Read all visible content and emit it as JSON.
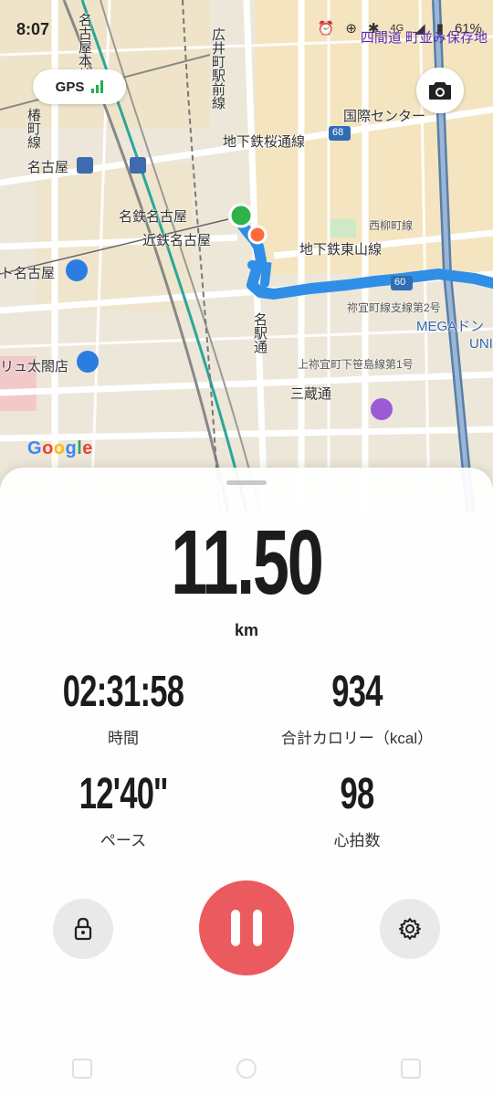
{
  "status_bar": {
    "time": "8:07",
    "icons": [
      "alarm-icon",
      "sync-icon",
      "bluetooth-icon",
      "4g-icon",
      "signal-icon",
      "battery-icon"
    ],
    "battery": "61%",
    "network": "4G",
    "overlay_text": "四間道 町並み保存地"
  },
  "gps": {
    "label": "GPS",
    "color": "#21b04b"
  },
  "map": {
    "labels": {
      "meieki_ave": "名駅通",
      "sakuradori": "地下鉄桜通線",
      "higashiyama": "地下鉄東山線",
      "nagoya_sta": "名古屋",
      "meitetsu": "名鉄名古屋",
      "kintetsu": "近鉄名古屋",
      "kokusai": "国際センター",
      "sanzo": "三蔵通",
      "taiko": "リュ太閤店",
      "nagoya2": "ト名古屋",
      "hirokoji": "広井町駅前線",
      "tsubakicho": "椿町線",
      "mega": "MEGAドン",
      "uni": "UNI",
      "nishiyanagi": "西柳町線",
      "negi": "祢宜町線支線第2号",
      "kami": "上祢宜町下笹島線第1号",
      "kinkoku": "名古屋本線",
      "road68": "68",
      "road60": "60"
    },
    "google": "Google",
    "route_color": "#2f8fe6"
  },
  "stats": {
    "distance": "11.50",
    "distance_unit": "km",
    "time_value": "02:31:58",
    "time_label": "時間",
    "calories_value": "934",
    "calories_label": "合計カロリー（kcal）",
    "pace_value": "12'40''",
    "pace_label": "ペース",
    "heart_value": "98",
    "heart_label": "心拍数"
  },
  "controls": {
    "lock": "lock-icon",
    "pause": "pause-icon",
    "settings": "gear-icon",
    "pause_color": "#eb5a5e"
  }
}
